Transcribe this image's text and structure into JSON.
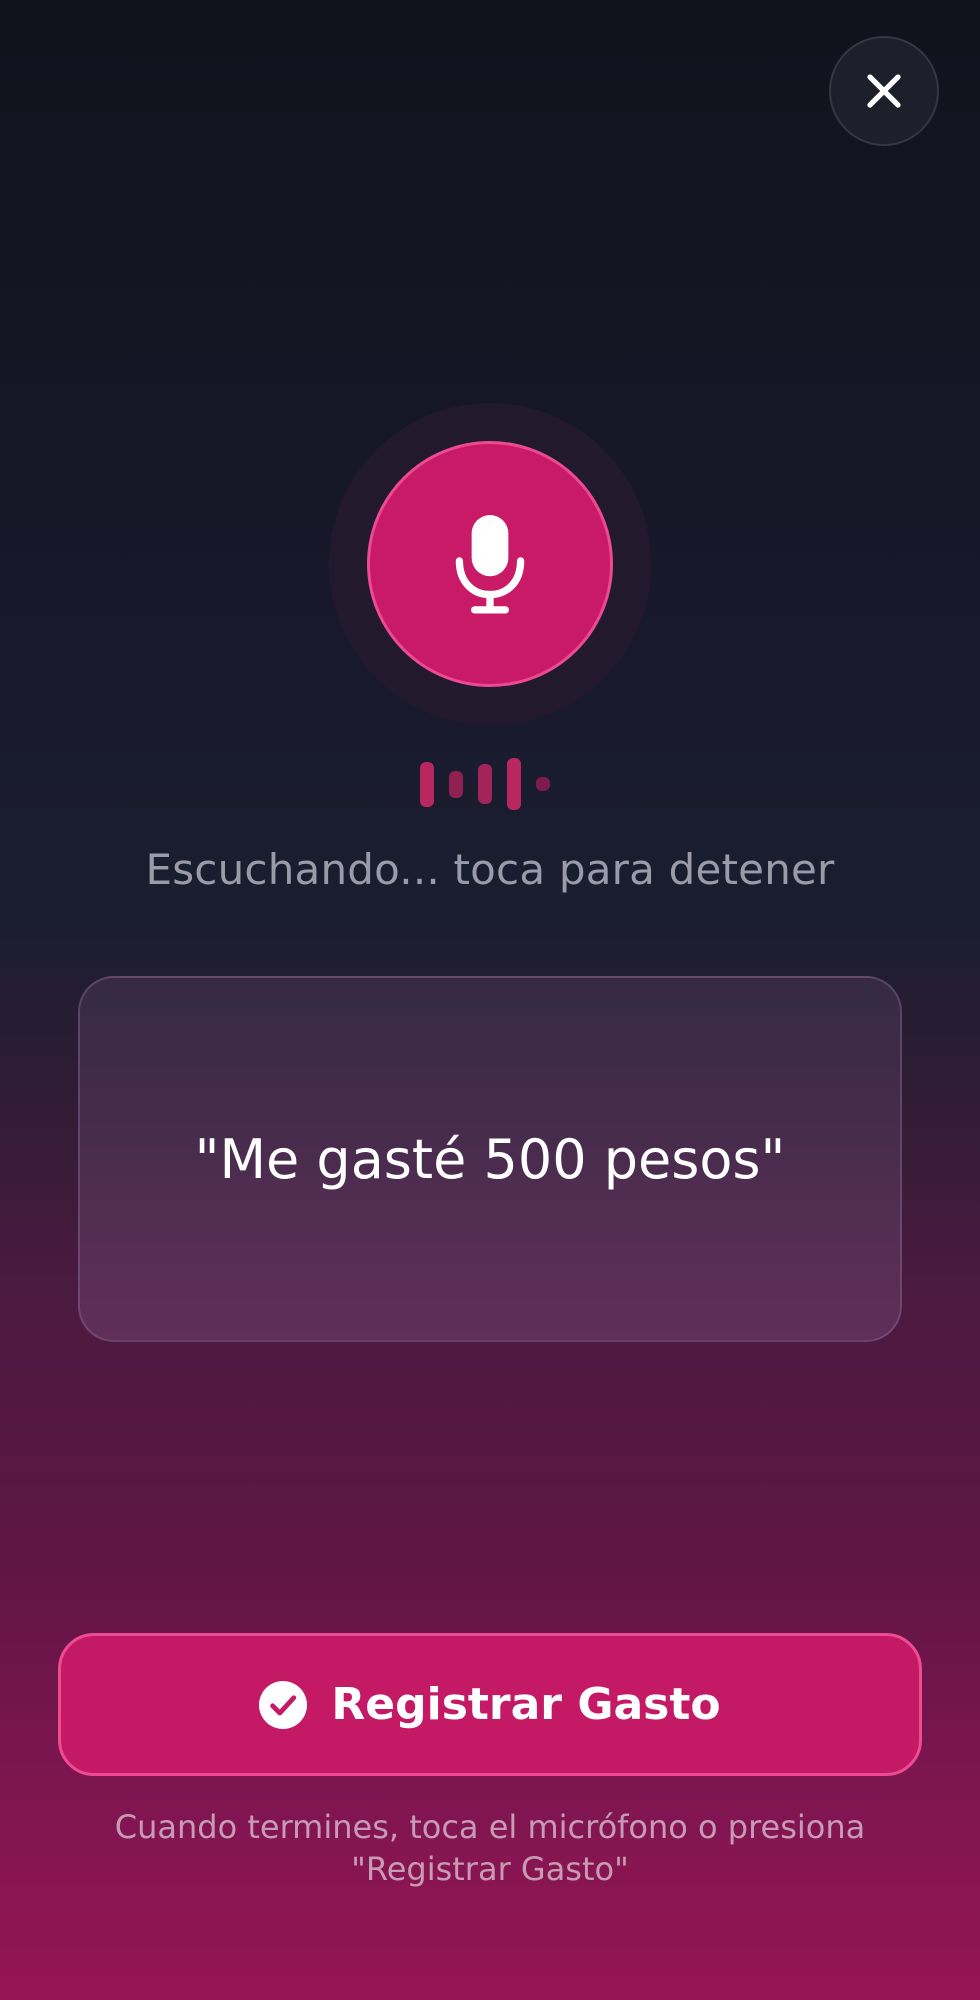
{
  "header": {
    "close_icon": "close-icon"
  },
  "recorder": {
    "mic_icon": "microphone-icon",
    "status_text": "Escuchando... toca para detener",
    "accent_color": "#c81a66",
    "level_bars": [
      0.62,
      0.38,
      0.55,
      0.72,
      0.2
    ]
  },
  "transcript": {
    "text": "\"Me gasté 500 pesos\""
  },
  "actions": {
    "primary_label": "Registrar Gasto",
    "primary_icon": "check-circle-icon",
    "hint_line1": "Cuando termines, toca el micrófono o presiona",
    "hint_line2": "\"Registrar Gasto\""
  }
}
